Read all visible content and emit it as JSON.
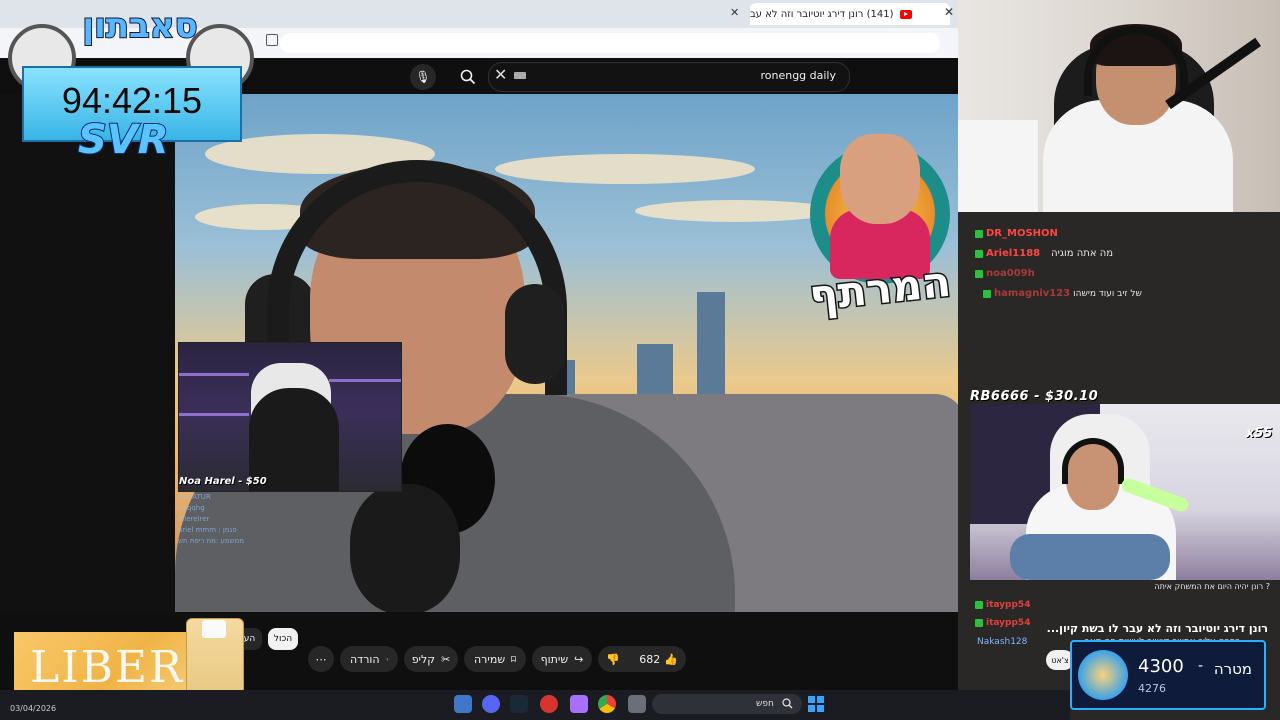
{
  "browser": {
    "tab_title": "(141) רונן דירג יוטיובר וזה לא עב",
    "tab_close": "✕",
    "new_tab": "+",
    "window_close": "✕"
  },
  "youtube": {
    "search_query": "ronengg daily",
    "clear": "✕",
    "mic_icon": "🎙"
  },
  "overlay": {
    "streamer_name": "סאבתון",
    "timer": "94:42:15",
    "svr": "SVR"
  },
  "video": {
    "show_logo": "המרתף",
    "inset_label": "Noa Harel - $50",
    "inset_chat": [
      "GUYATUR",
      "hqqqhg",
      "ellerelrer",
      "ariel mmm : פגמן",
      "ממשמע :מת ריפת תש"
    ]
  },
  "right_chat": {
    "rows": [
      {
        "name": "DR_MOSHON",
        "msg": ""
      },
      {
        "name": "Ariel1188",
        "msg": "מה אתה מוגיה"
      },
      {
        "name": "noa009h",
        "msg": ""
      },
      {
        "name": "hamagniv123",
        "msg": "של זיב ועוד מישהו"
      }
    ],
    "donation": "RB6666 - $30.10",
    "multiplier": "x55",
    "rows2": [
      {
        "name": "",
        "msg": "רונן יהיה היום את המשחק איתה ?"
      },
      {
        "name": "itaypp54",
        "msg": ""
      },
      {
        "name": "itaypp54",
        "msg": ""
      }
    ]
  },
  "video_info": {
    "title": "רונן דירג יוטיובר וזה לא עבר לו בשת קיון...",
    "comment_author": "Nakash128",
    "comment_text": "כפרה עליך אפשר קישור לעשות פה סאב",
    "likes": "682",
    "share": "שיתוף",
    "save": "שמירה",
    "clip": "קליפ",
    "download": "הורדה",
    "more": "⋯",
    "chip_all": "הכול",
    "chip_other": "העל"
  },
  "goal": {
    "label": "מטרה",
    "dash": "-",
    "current": "4300",
    "target": "4276"
  },
  "chat_input_label": "צ'אט",
  "ad": {
    "brand": "LIBERO"
  },
  "taskbar": {
    "date": "03/04/2026",
    "search_label": "חפש"
  },
  "colors": {
    "youtube_red": "#ff0000",
    "timer_blue": "#39b4e6",
    "chat_name_red": "#ff4545",
    "goal_border": "#29b1ff"
  }
}
